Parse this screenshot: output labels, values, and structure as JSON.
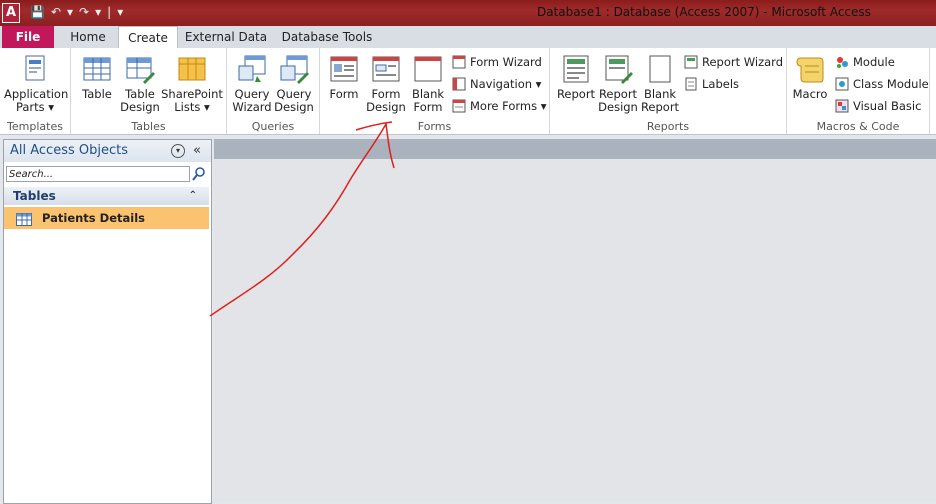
{
  "window": {
    "title": "Database1 : Database (Access 2007)  -  Microsoft Access",
    "app_letter": "A"
  },
  "qat": [
    "💾",
    "↶",
    "▾",
    "↷",
    "▾",
    "|",
    "▾"
  ],
  "tabs": [
    {
      "label": "File"
    },
    {
      "label": "Home"
    },
    {
      "label": "Create"
    },
    {
      "label": "External Data"
    },
    {
      "label": "Database Tools"
    }
  ],
  "ribbon": {
    "templates": {
      "label": "Templates",
      "application_parts": [
        "Application",
        "Parts ▾"
      ]
    },
    "tables": {
      "label": "Tables",
      "table": [
        "Table"
      ],
      "table_design": [
        "Table",
        "Design"
      ],
      "sharepoint_lists": [
        "SharePoint",
        "Lists ▾"
      ]
    },
    "queries": {
      "label": "Queries",
      "query_wizard": [
        "Query",
        "Wizard"
      ],
      "query_design": [
        "Query",
        "Design"
      ]
    },
    "forms": {
      "label": "Forms",
      "form": [
        "Form"
      ],
      "form_design": [
        "Form",
        "Design"
      ],
      "blank_form": [
        "Blank",
        "Form"
      ],
      "form_wizard": "Form Wizard",
      "navigation": "Navigation ▾",
      "more_forms": "More Forms ▾"
    },
    "reports": {
      "label": "Reports",
      "report": [
        "Report"
      ],
      "report_design": [
        "Report",
        "Design"
      ],
      "blank_report": [
        "Blank",
        "Report"
      ],
      "report_wizard": "Report Wizard",
      "labels": "Labels"
    },
    "macros": {
      "label": "Macros & Code",
      "macro": [
        "Macro"
      ],
      "module": "Module",
      "class_module": "Class Module",
      "visual_basic": "Visual Basic"
    }
  },
  "nav_pane": {
    "header": "All Access Objects",
    "search_placeholder": "Search...",
    "section": "Tables",
    "items": [
      {
        "label": "Patients Details"
      }
    ]
  },
  "colors": {
    "title_bar": "#8b1f1f",
    "file_tab": "#c2185b",
    "selected_item": "#fbc36f",
    "annotation": "#e0201e"
  }
}
